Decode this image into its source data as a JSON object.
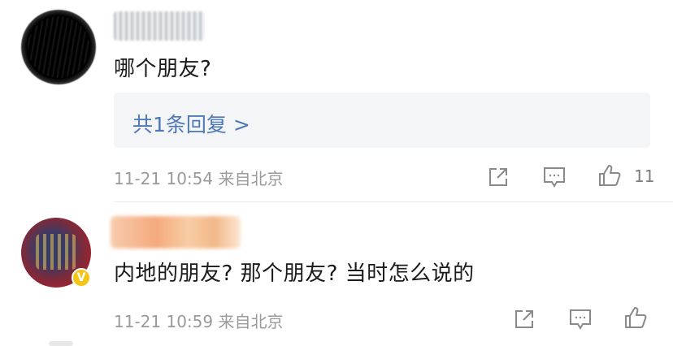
{
  "comments": [
    {
      "text": "哪个朋友?",
      "reply_summary": "共1条回复 >",
      "meta": "11-21 10:54 来自北京",
      "like_count": "11"
    },
    {
      "text": "内地的朋友? 那个朋友? 当时怎么说的",
      "meta": "11-21 10:59 来自北京",
      "verified_badge": "V"
    }
  ],
  "icons": {
    "share": "share-icon",
    "comment": "comment-icon",
    "like": "thumbs-up-icon"
  },
  "colors": {
    "link": "#4c78b8",
    "meta_text": "#9a9a9a",
    "reply_bg": "#f4f5f7",
    "icon": "#8a8a8a"
  }
}
